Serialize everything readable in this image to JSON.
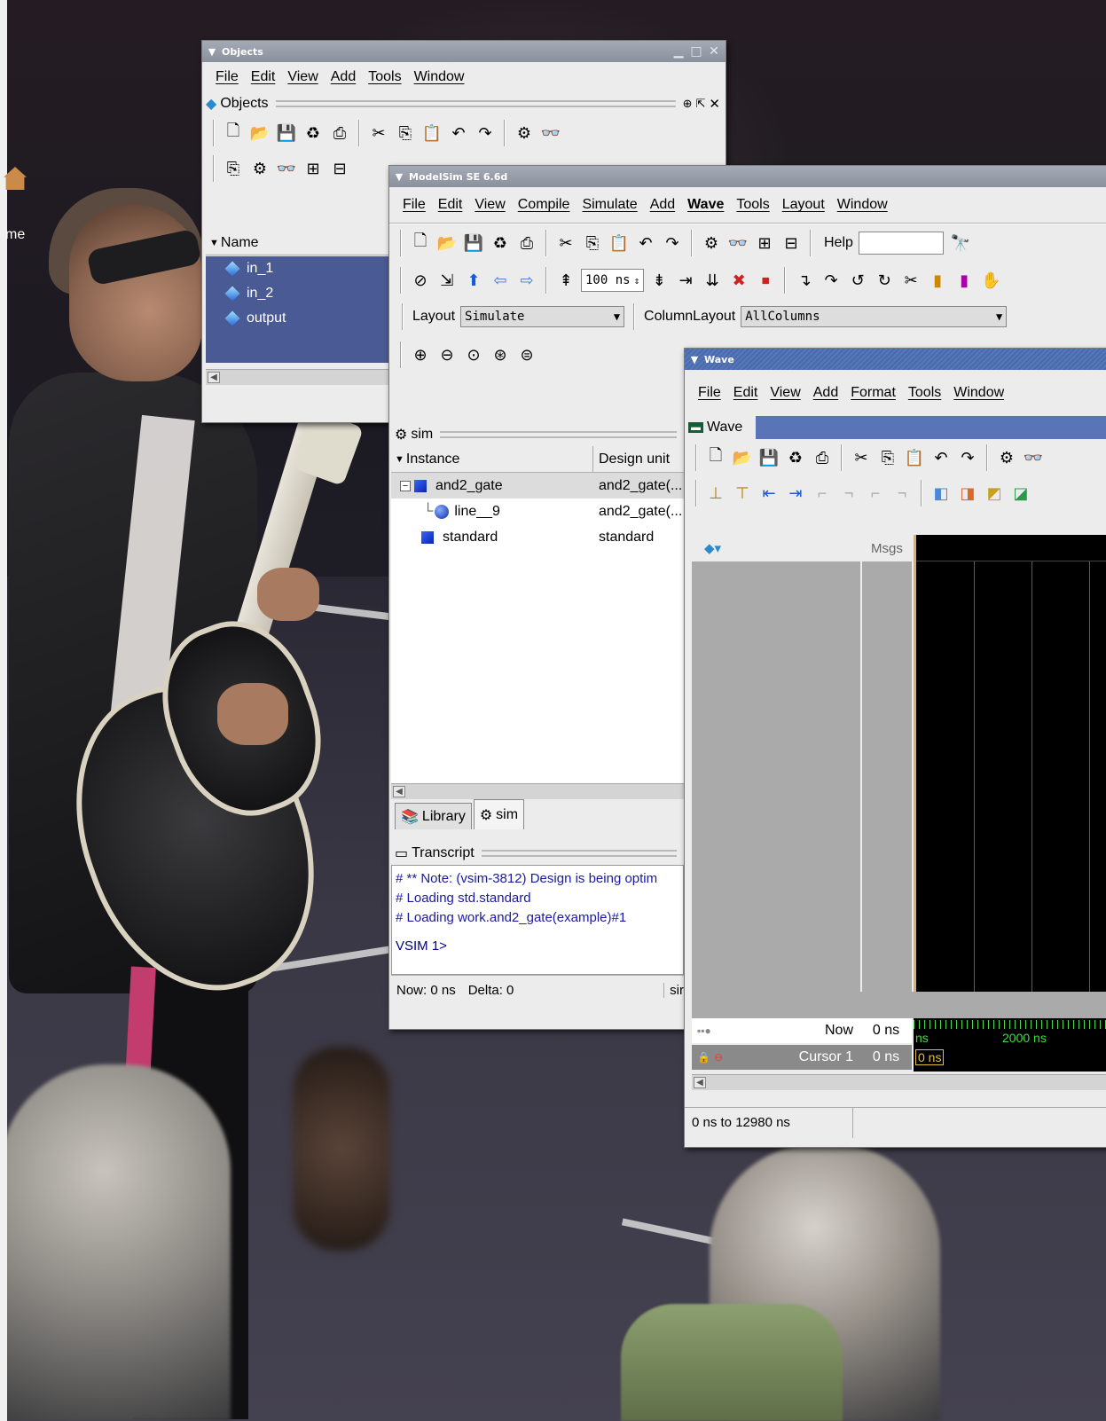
{
  "desktop": {
    "icon_label": "me"
  },
  "objects_window": {
    "title": "Objects",
    "menu": [
      "File",
      "Edit",
      "View",
      "Add",
      "Tools",
      "Window"
    ],
    "pane_title": "Objects",
    "column_header": "Name",
    "items": [
      "in_1",
      "in_2",
      "output"
    ]
  },
  "main_window": {
    "title": "ModelSim SE 6.6d",
    "menu": [
      "File",
      "Edit",
      "View",
      "Compile",
      "Simulate",
      "Add",
      "Wave",
      "Tools",
      "Layout",
      "Window"
    ],
    "help_label": "Help",
    "run_length": "100 ns",
    "layout_label": "Layout",
    "layout_value": "Simulate",
    "column_layout_label": "ColumnLayout",
    "column_layout_value": "AllColumns",
    "sim_pane_title": "sim",
    "columns": [
      "Instance",
      "Design unit"
    ],
    "instances": [
      {
        "name": "and2_gate",
        "unit": "and2_gate(..."
      },
      {
        "name": "line__9",
        "unit": "and2_gate(..."
      },
      {
        "name": "standard",
        "unit": "standard"
      }
    ],
    "tabs": [
      "Library",
      "sim"
    ],
    "transcript_title": "Transcript",
    "transcript_lines": [
      "# ** Note: (vsim-3812) Design is being optim",
      "# Loading std.standard",
      "# Loading work.and2_gate(example)#1"
    ],
    "prompt": "VSIM 1>",
    "status_now": "Now: 0 ns",
    "status_delta": "Delta: 0",
    "status_right": "sir"
  },
  "wave_window": {
    "title": "Wave",
    "menu": [
      "File",
      "Edit",
      "View",
      "Add",
      "Format",
      "Tools",
      "Window"
    ],
    "pane_title": "Wave",
    "msgs_header": "Msgs",
    "now_label": "Now",
    "now_value": "0 ns",
    "cursor_label": "Cursor 1",
    "cursor_value": "0 ns",
    "cursor_time_tag": "0 ns",
    "timeline_left": "ns",
    "timeline_tick": "2000 ns",
    "range": "0 ns to 12980 ns"
  }
}
